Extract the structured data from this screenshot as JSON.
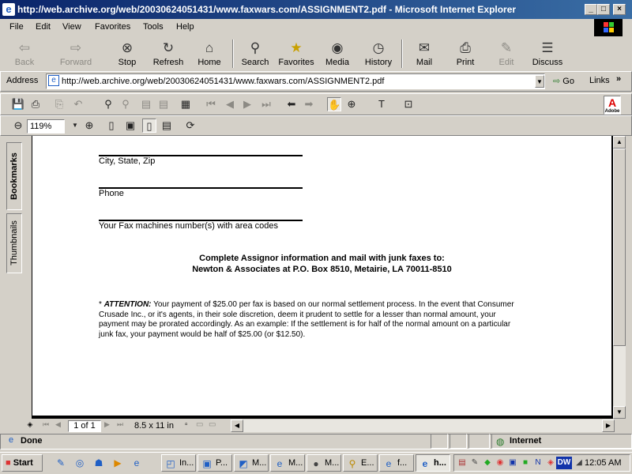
{
  "window": {
    "title": "http://web.archive.org/web/20030624051431/www.faxwars.com/ASSIGNMENT2.pdf - Microsoft Internet Explorer",
    "controls": {
      "minimize": "_",
      "maximize": "□",
      "close": "×"
    }
  },
  "menu": [
    "File",
    "Edit",
    "View",
    "Favorites",
    "Tools",
    "Help"
  ],
  "toolbar": [
    {
      "label": "Back",
      "icon": "back-arrow-icon",
      "glyph": "⇦",
      "enabled": false
    },
    {
      "label": "Forward",
      "icon": "forward-arrow-icon",
      "glyph": "⇨",
      "enabled": false
    },
    {
      "label": "Stop",
      "icon": "stop-icon",
      "glyph": "⊗",
      "enabled": true
    },
    {
      "label": "Refresh",
      "icon": "refresh-icon",
      "glyph": "↻",
      "enabled": true
    },
    {
      "label": "Home",
      "icon": "home-icon",
      "glyph": "⌂",
      "enabled": true
    },
    {
      "label": "Search",
      "icon": "search-icon",
      "glyph": "⚲",
      "enabled": true
    },
    {
      "label": "Favorites",
      "icon": "favorites-icon",
      "glyph": "★",
      "enabled": true
    },
    {
      "label": "Media",
      "icon": "media-icon",
      "glyph": "◉",
      "enabled": true
    },
    {
      "label": "History",
      "icon": "history-icon",
      "glyph": "◷",
      "enabled": true
    },
    {
      "label": "Mail",
      "icon": "mail-icon",
      "glyph": "✉",
      "enabled": true
    },
    {
      "label": "Print",
      "icon": "print-icon",
      "glyph": "⎙",
      "enabled": true
    },
    {
      "label": "Edit",
      "icon": "edit-icon",
      "glyph": "✎",
      "enabled": false
    },
    {
      "label": "Discuss",
      "icon": "discuss-icon",
      "glyph": "☰",
      "enabled": true
    }
  ],
  "address": {
    "label": "Address",
    "url": "http://web.archive.org/web/20030624051431/www.faxwars.com/ASSIGNMENT2.pdf",
    "go": "Go",
    "links": "Links"
  },
  "acrobat": {
    "zoom": "119%",
    "adobe": "A",
    "adobe_sub": "Adobe"
  },
  "nav_tabs": {
    "bookmarks": "Bookmarks",
    "thumbnails": "Thumbnails"
  },
  "document": {
    "fields": [
      "City, State, Zip",
      "Phone",
      "Your Fax machines number(s) with area codes"
    ],
    "instruction_line1": "Complete Assignor information and mail with junk faxes to:",
    "instruction_line2": "Newton & Associates at P.O. Box 8510, Metairie, LA  70011-8510",
    "attention_marker": "*",
    "attention_label": "ATTENTION:",
    "attention_text": " Your payment of $25.00 per fax is based on our normal settlement process. In the event that Consumer Crusade Inc., or it's agents, in their sole discretion, deem it prudent to settle for a lesser than normal amount, your payment may be prorated accordingly.  As an example: If the settlement is for half of the normal amount on a particular junk fax, your payment would be half of $25.00 (or $12.50)."
  },
  "pagebar": {
    "page": "1 of 1",
    "size": "8.5 x 11 in"
  },
  "status": {
    "text": "Done",
    "zone": "Internet"
  },
  "taskbar": {
    "start": "Start",
    "tasks": [
      "In...",
      "P...",
      "M...",
      "M...",
      "M...",
      "E...",
      "f...",
      "h..."
    ],
    "clock": "12:05 AM"
  }
}
